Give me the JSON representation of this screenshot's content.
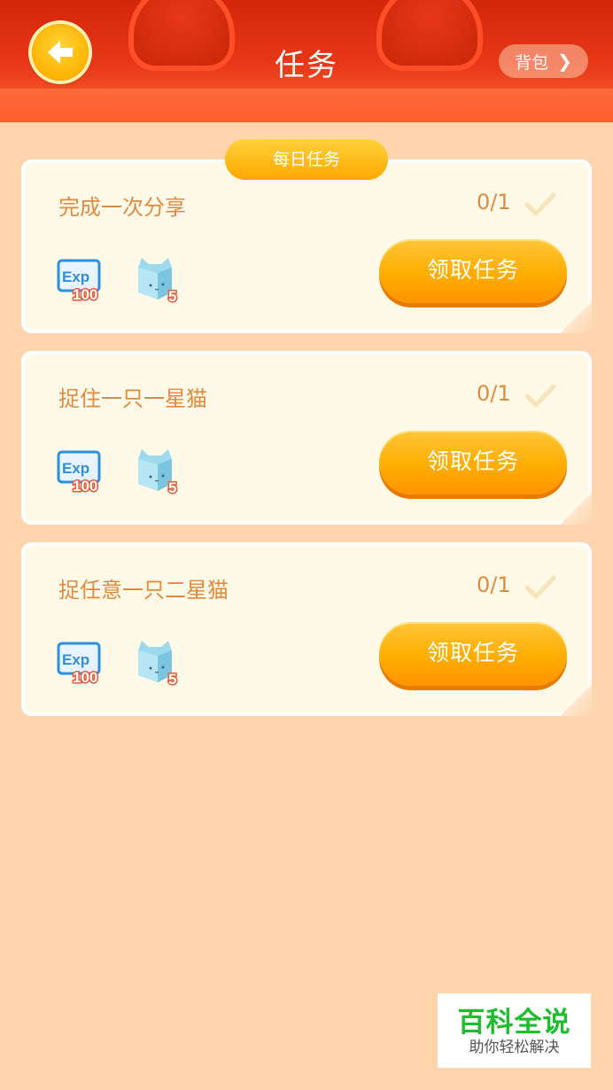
{
  "header": {
    "title": "任务",
    "back_icon": "arrow-left-icon",
    "bag_label": "背包",
    "bag_icon": "chevron-right-icon"
  },
  "section": {
    "label": "每日任务"
  },
  "tasks": [
    {
      "name": "完成一次分享",
      "progress": "0/1",
      "exp_text": "Exp",
      "exp_amount": "100",
      "item_count": "5",
      "button": "领取任务"
    },
    {
      "name": "捉住一只一星猫",
      "progress": "0/1",
      "exp_text": "Exp",
      "exp_amount": "100",
      "item_count": "5",
      "button": "领取任务"
    },
    {
      "name": "捉任意一只二星猫",
      "progress": "0/1",
      "exp_text": "Exp",
      "exp_amount": "100",
      "item_count": "5",
      "button": "领取任务"
    }
  ],
  "watermark": {
    "title": "百科全说",
    "subtitle": "助你轻松解决"
  },
  "colors": {
    "header": "#e9391a",
    "background": "#ffd5ae",
    "button": "#ffad00",
    "task_text": "#e28a3e",
    "watermark_green": "#1fbd2d"
  }
}
